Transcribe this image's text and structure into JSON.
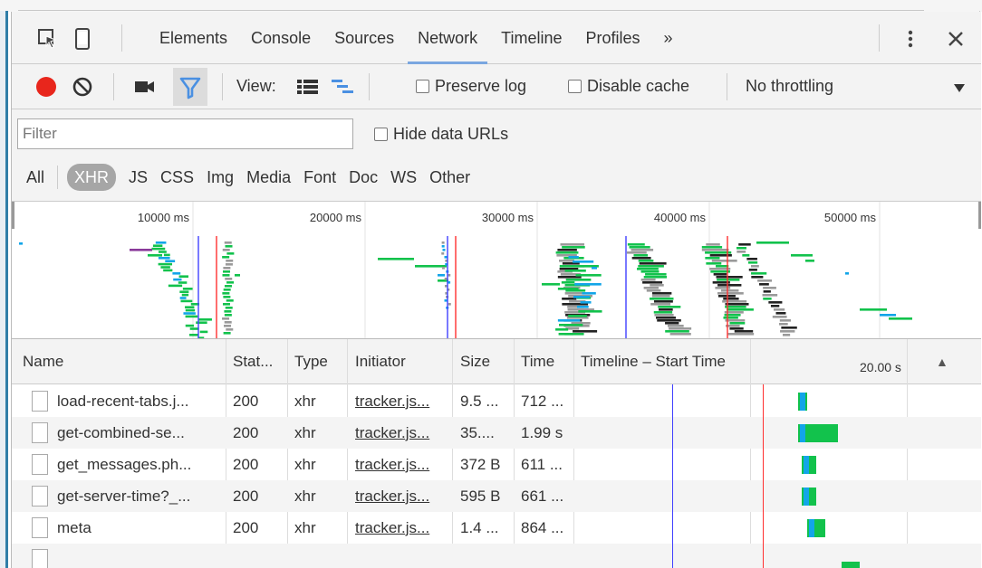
{
  "tabs": [
    {
      "label": "Elements"
    },
    {
      "label": "Console"
    },
    {
      "label": "Sources"
    },
    {
      "label": "Network"
    },
    {
      "label": "Timeline"
    },
    {
      "label": "Profiles"
    },
    {
      "label": "»"
    }
  ],
  "active_tab": "Network",
  "toolbar": {
    "view_label": "View:",
    "preserve_log": "Preserve log",
    "disable_cache": "Disable cache",
    "throttling": "No throttling"
  },
  "filter": {
    "placeholder": "Filter",
    "hide_data_urls": "Hide data URLs"
  },
  "resource_types": [
    "All",
    "XHR",
    "JS",
    "CSS",
    "Img",
    "Media",
    "Font",
    "Doc",
    "WS",
    "Other"
  ],
  "active_type": "XHR",
  "overview_ticks": [
    "10000 ms",
    "20000 ms",
    "30000 ms",
    "40000 ms",
    "50000 ms"
  ],
  "columns": {
    "name": "Name",
    "status": "Stat...",
    "type": "Type",
    "initiator": "Initiator",
    "size": "Size",
    "time": "Time",
    "timeline": "Timeline – Start Time",
    "scale": "20.00 s",
    "sort": "▲"
  },
  "requests": [
    {
      "name": "load-recent-tabs.j...",
      "status": "200",
      "type": "xhr",
      "initiator": "tracker.js...",
      "size": "9.5 ...",
      "time": "712 ..."
    },
    {
      "name": "get-combined-se...",
      "status": "200",
      "type": "xhr",
      "initiator": "tracker.js...",
      "size": "35....",
      "time": "1.99 s"
    },
    {
      "name": "get_messages.ph...",
      "status": "200",
      "type": "xhr",
      "initiator": "tracker.js...",
      "size": "372 B",
      "time": "611 ..."
    },
    {
      "name": "get-server-time?_...",
      "status": "200",
      "type": "xhr",
      "initiator": "tracker.js...",
      "size": "595 B",
      "time": "661 ..."
    },
    {
      "name": "meta",
      "status": "200",
      "type": "xhr",
      "initiator": "tracker.js...",
      "size": "1.4 ...",
      "time": "864 ..."
    }
  ],
  "colors": {
    "record": "#e8261c",
    "filter_active": "#4a90e2",
    "bar_green": "#12c24c",
    "bar_blue": "#12a5e8",
    "dom_line": "#4040ff",
    "load_line": "#ff3030"
  }
}
